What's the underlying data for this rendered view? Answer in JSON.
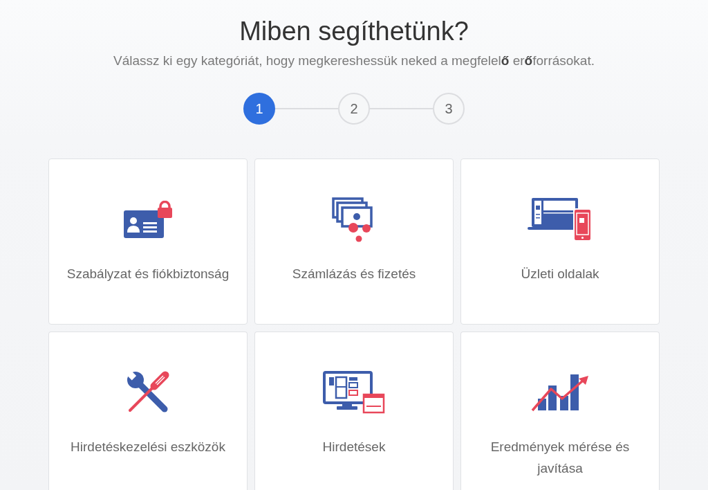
{
  "heading": "Miben segíthetünk?",
  "subheading": "Válassz ki egy kategóriát, hogy megkereshessük neked a megfelel**ő** er**ő**forrásokat.",
  "steps": [
    {
      "label": "1",
      "selected": true
    },
    {
      "label": "2",
      "selected": false
    },
    {
      "label": "3",
      "selected": false
    }
  ],
  "categories": [
    {
      "label": "Szabályzat és fiókbiztonság",
      "kind": "idcard"
    },
    {
      "label": "Számlázás és fizetés",
      "kind": "banknotes"
    },
    {
      "label": "Üzleti oldalak",
      "kind": "devices"
    },
    {
      "label": "Hirdetéskezelési eszközök",
      "kind": "tools"
    },
    {
      "label": "Hirdetések",
      "kind": "monitor"
    },
    {
      "label": "Eredmények mérése és javítása",
      "kind": "chart"
    }
  ]
}
